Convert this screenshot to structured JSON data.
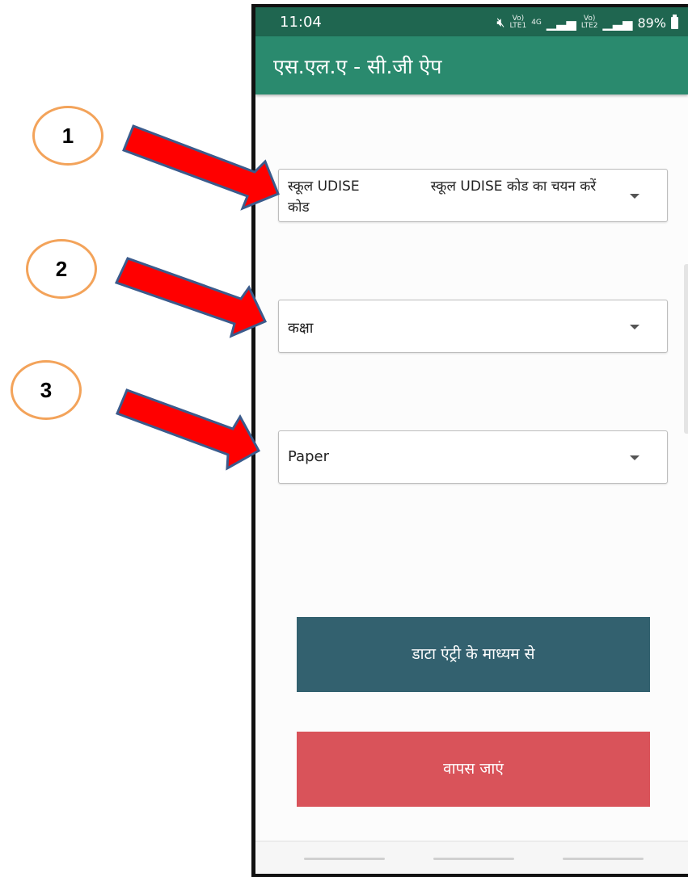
{
  "statusbar": {
    "time": "11:04",
    "battery": "89%",
    "network": "4G"
  },
  "appbar": {
    "title": "एस.एल.ए - सी.जी ऐप"
  },
  "form": {
    "school_udise": {
      "label": "स्कूल UDISE कोड",
      "placeholder": "स्कूल UDISE कोड का चयन करें"
    },
    "class": {
      "label": "कक्षा"
    },
    "paper": {
      "label": "Paper"
    }
  },
  "buttons": {
    "data_entry": "डाटा एंट्री के माध्यम से",
    "back": "वापस जाएं"
  },
  "annotations": {
    "step1": "1",
    "step2": "2",
    "step3": "3"
  },
  "colors": {
    "statusbar": "#1f6650",
    "appbar": "#2a8a6e",
    "data_entry_button": "#33616f",
    "back_button": "#d9535a",
    "arrow_fill": "#ff0000",
    "arrow_outline": "#3b5b8c",
    "circle_border": "#f3a35a"
  }
}
